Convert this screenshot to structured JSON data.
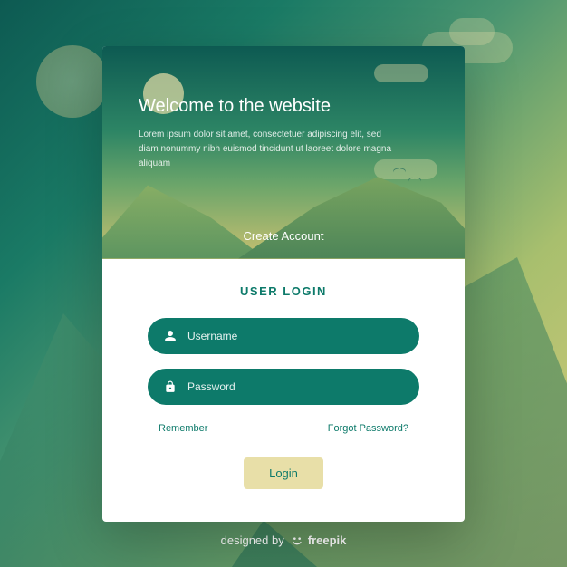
{
  "hero": {
    "title": "Welcome to the website",
    "subtitle": "Lorem ipsum dolor sit amet, consectetuer adipiscing elit, sed diam nonummy nibh euismod tincidunt ut laoreet dolore magna aliquam",
    "create_account_label": "Create Account"
  },
  "form": {
    "title": "USER LOGIN",
    "username_placeholder": "Username",
    "password_placeholder": "Password",
    "remember_label": "Remember",
    "forgot_label": "Forgot Password?",
    "login_button_label": "Login"
  },
  "footer": {
    "designed_by": "designed by",
    "brand": "freepik"
  }
}
